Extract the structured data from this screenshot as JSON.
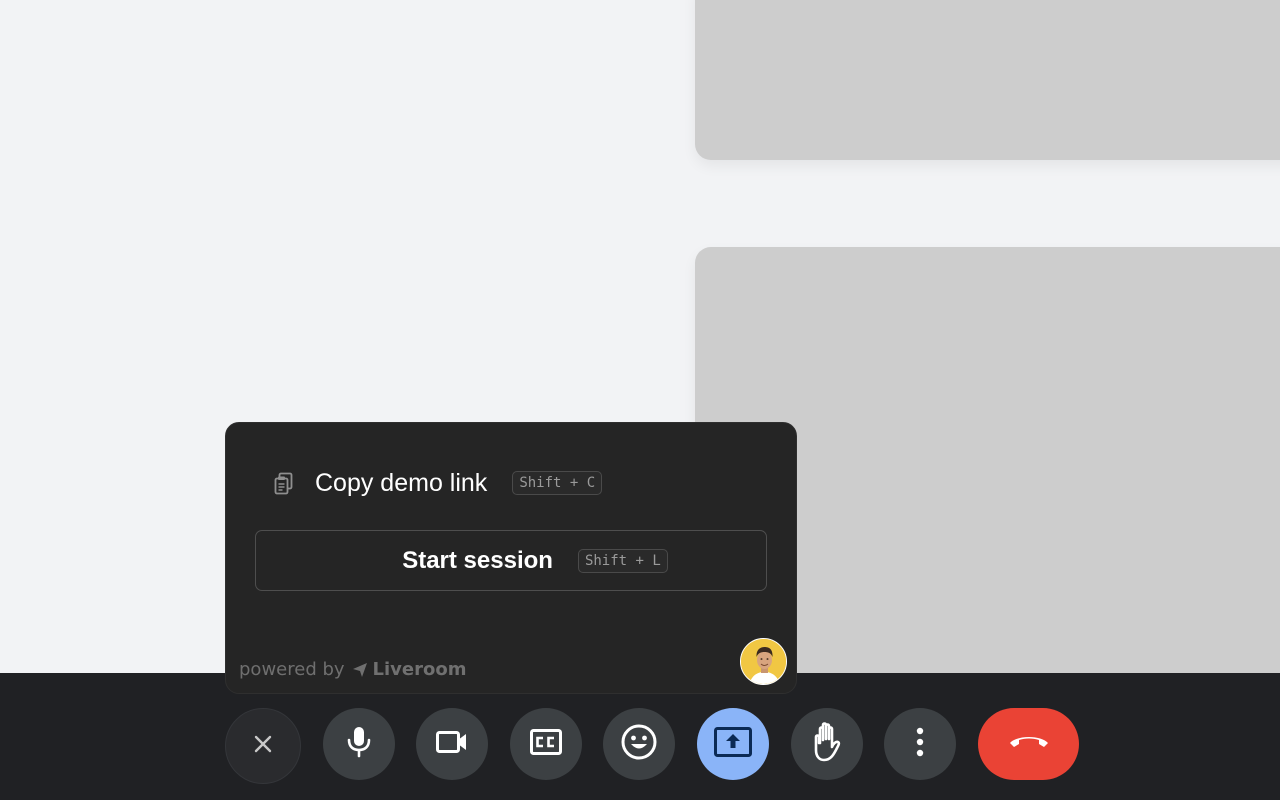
{
  "popover": {
    "copy_link_label": "Copy demo link",
    "copy_link_shortcut": "Shift + C",
    "start_session_label": "Start session",
    "start_session_shortcut": "Shift + L",
    "powered_by_prefix": "powered by",
    "brand_name": "Liveroom"
  },
  "controls": [
    {
      "name": "close",
      "icon": "close-icon"
    },
    {
      "name": "microphone",
      "icon": "mic-icon"
    },
    {
      "name": "camera",
      "icon": "video-camera-icon"
    },
    {
      "name": "captions",
      "icon": "closed-captions-icon"
    },
    {
      "name": "reactions",
      "icon": "emoji-icon"
    },
    {
      "name": "present",
      "icon": "present-screen-icon",
      "active": true
    },
    {
      "name": "raise-hand",
      "icon": "raise-hand-icon"
    },
    {
      "name": "more-options",
      "icon": "more-vertical-icon"
    },
    {
      "name": "leave-call",
      "icon": "hang-up-icon"
    }
  ],
  "colors": {
    "background": "#f2f3f5",
    "tile": "#cdcdcd",
    "control_bar": "#202124",
    "control_button": "#3c4043",
    "present_active": "#8ab4f8",
    "end_call": "#ea4335",
    "popover": "#252525"
  }
}
